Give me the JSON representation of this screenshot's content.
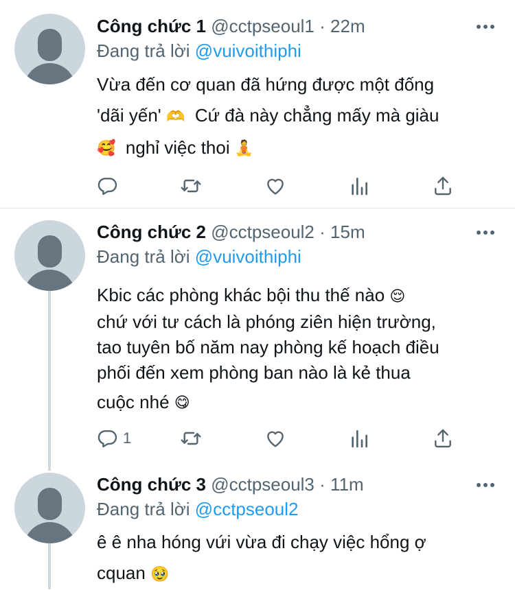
{
  "tweets": [
    {
      "name": "Công chức 1",
      "handle": "@cctpseoul1",
      "separator": "·",
      "time": "22m",
      "reply_prefix": "Đang trả lời",
      "reply_to": "@vuivoithiphi",
      "lines": [
        "Vừa đến cơ quan đã hứng được một đống",
        "'dãi yến'",
        "Cứ đà này chẳng mấy mà giàu",
        "nghỉ việc thoi"
      ],
      "emojis": [
        "🫶",
        "🥰",
        "🧘"
      ],
      "reply_count": ""
    },
    {
      "name": "Công chức 2",
      "handle": "@cctpseoul2",
      "separator": "·",
      "time": "15m",
      "reply_prefix": "Đang trả lời",
      "reply_to": "@vuivoithiphi",
      "lines": [
        "Kbic các phòng khác bội thu thế nào",
        "chứ với tư cách là phóng ziên hiện trường,",
        "tao tuyên bố năm nay phòng kế hoạch điều",
        "phối đến xem phòng ban nào là kẻ thua",
        "cuộc nhé"
      ],
      "emojis": [
        "😌",
        "😋"
      ],
      "reply_count": "1"
    },
    {
      "name": "Công chức 3",
      "handle": "@cctpseoul3",
      "separator": "·",
      "time": "11m",
      "reply_prefix": "Đang trả lời",
      "reply_to": "@cctpseoul2",
      "lines": [
        "ê ê nha hóng vứi vừa đi chạy việc hổng ợ",
        "cquan"
      ],
      "emojis": [
        "🥹"
      ]
    }
  ],
  "icons": [
    "reply-icon",
    "retweet-icon",
    "like-icon",
    "analytics-icon",
    "share-icon",
    "more-icon",
    "avatar-icon"
  ],
  "colors": {
    "text": "#0f1419",
    "secondary": "#536471",
    "link": "#1d9bf0",
    "avatar_bg": "#ccd6dd",
    "avatar_fg": "#66757f"
  }
}
